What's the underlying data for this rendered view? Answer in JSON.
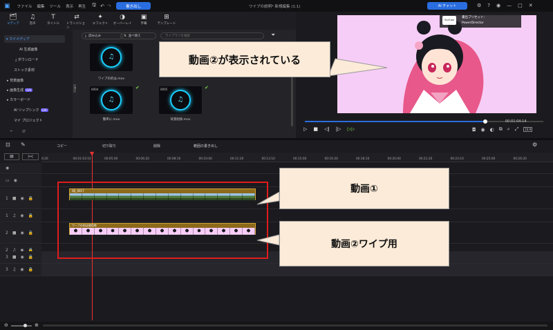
{
  "titlebar": {
    "menu": [
      "ファイル",
      "編集",
      "ツール",
      "表示",
      "再生"
    ],
    "export": "書き出し",
    "title": "ワイプの説明* 新規編集 (1:1)",
    "ai_chat": "AI チャット"
  },
  "tools": [
    {
      "icon": "🗂",
      "label": "メディア"
    },
    {
      "icon": "♫",
      "label": "音声"
    },
    {
      "icon": "T",
      "label": "タイトル"
    },
    {
      "icon": "⇄",
      "label": "トランジション"
    },
    {
      "icon": "✦",
      "label": "エフェクト"
    },
    {
      "icon": "◑",
      "label": "オーバーレイ"
    },
    {
      "icon": "▣",
      "label": "字幕"
    },
    {
      "icon": "⊞",
      "label": "テンプレート"
    }
  ],
  "sidebar": {
    "items": [
      {
        "label": "▾ マイメディア"
      },
      {
        "label": "AI 生成画像"
      },
      {
        "label": "⤓ ダウンロード"
      },
      {
        "label": "ストック素材"
      },
      {
        "label": "▸ 背景画像"
      },
      {
        "label": "▸ 画像生成",
        "badge": "GAI"
      },
      {
        "label": "▸ カラーボード"
      },
      {
        "label": "AI リップシンク",
        "badge": "GAI"
      },
      {
        "label": "マイ プロジェクト"
      }
    ]
  },
  "media": {
    "import": "読み込み",
    "sort": "並べ替え",
    "search_placeholder": "ライブラリを検索",
    "items": [
      {
        "label": "ワイプの的は.mov",
        "dur": ""
      },
      {
        "label": "",
        "dur": ""
      },
      {
        "label": "簡単に.mov",
        "dur": "0004"
      },
      {
        "label": "背景削除.mov",
        "dur": "0005"
      }
    ]
  },
  "preview": {
    "preset_label": "書出プリセット：",
    "preset_value": "PowerDirector",
    "badge_text": "YouTube",
    "timecode": "00:01:04:14",
    "ratio": "16:9"
  },
  "timeline": {
    "actions": [
      "コピー",
      "切り取り",
      "削除",
      "範囲の書き出し"
    ],
    "ticks": [
      "0:20",
      "00:01:03:10",
      "00:05:00",
      "00:06:20",
      "00:08:10",
      "00:10:00",
      "00:11:20",
      "00:13:10",
      "00:15:00",
      "00:16:20",
      "00:18:10",
      "00:20:00",
      "00:21:20",
      "00:23:10",
      "00:25:00",
      "00:26:20"
    ],
    "tracks": [
      "1",
      "1",
      "2",
      "2",
      "3",
      "3"
    ],
    "clip1_name": "DJI_0017",
    "clip2_name": "ワープの的は使用時",
    "frame_count": 15
  },
  "callouts": {
    "top": "動画②が表示されている",
    "clip1": "動画①",
    "clip2": "動画②ワイプ用"
  },
  "colors": {
    "accent": "#2a6de0",
    "clip": "#b08a2a",
    "highlight": "#e11c1c",
    "callout": "#fcebd8"
  }
}
